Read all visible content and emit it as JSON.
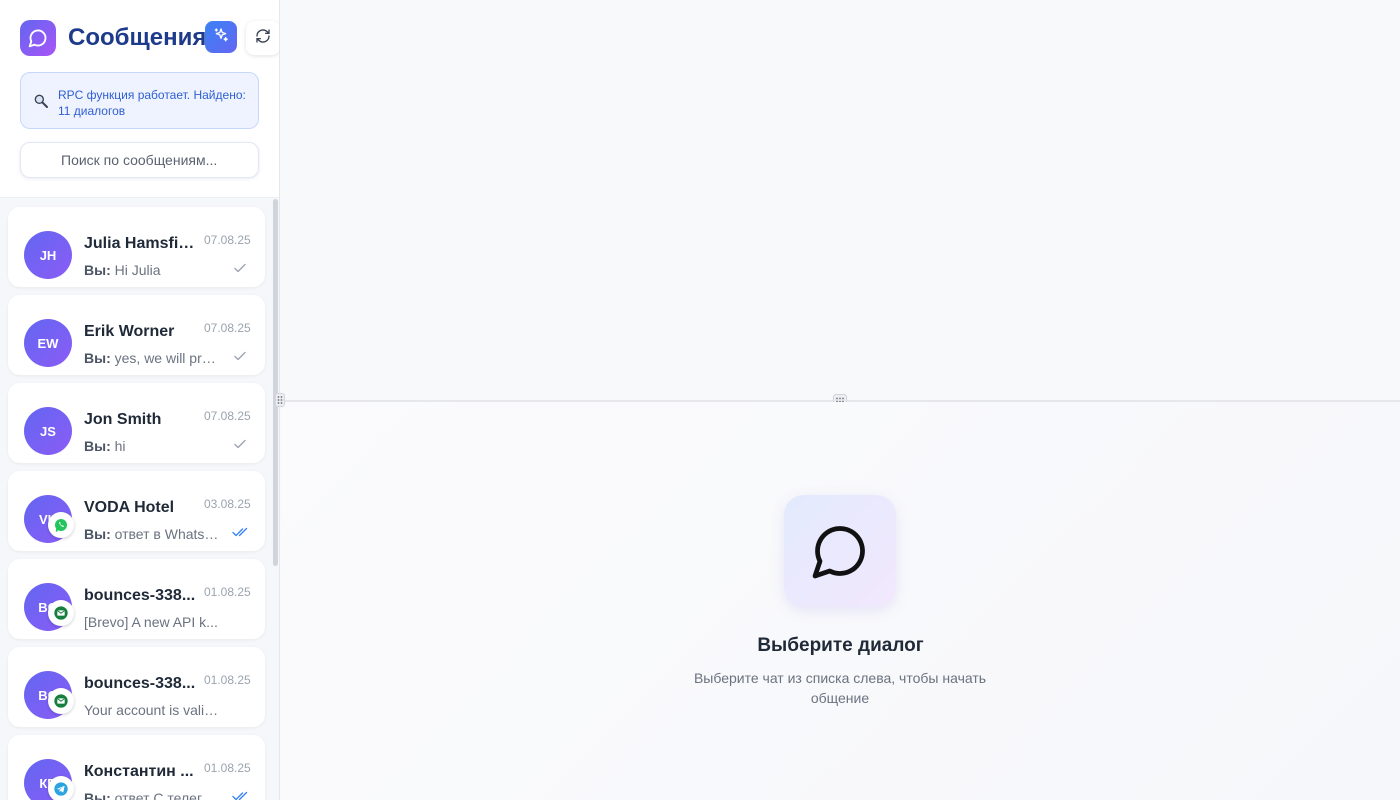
{
  "sidebar": {
    "title": "Сообщения",
    "rpc_status": "RPC функция работает. Найдено: 11 диалогов",
    "search": {
      "placeholder": "Поиск по сообщениям...",
      "value": ""
    },
    "conversations": [
      {
        "initials": "JH",
        "name": "Julia Hamsfield",
        "date": "07.08.25",
        "sender": "Вы:",
        "preview": "Hi Julia",
        "channel": "",
        "status": "sent"
      },
      {
        "initials": "EW",
        "name": "Erik Worner",
        "date": "07.08.25",
        "sender": "Вы:",
        "preview": "yes, we will pro...",
        "channel": "",
        "status": "sent"
      },
      {
        "initials": "JS",
        "name": "Jon Smith",
        "date": "07.08.25",
        "sender": "Вы:",
        "preview": "hi",
        "channel": "",
        "status": "sent"
      },
      {
        "initials": "VH",
        "name": "VODA Hotel",
        "date": "03.08.25",
        "sender": "Вы:",
        "preview": "ответ в Whatsa...",
        "channel": "whatsapp",
        "status": "read"
      },
      {
        "initials": "BO",
        "name": "bounces-338...",
        "date": "01.08.25",
        "sender": "",
        "preview": "[Brevo] A new API k...",
        "channel": "email",
        "status": ""
      },
      {
        "initials": "BO",
        "name": "bounces-338...",
        "date": "01.08.25",
        "sender": "",
        "preview": "Your account is valid...",
        "channel": "email",
        "status": ""
      },
      {
        "initials": "КП",
        "name": "Константин ...",
        "date": "01.08.25",
        "sender": "Вы:",
        "preview": "ответ С телеги ...",
        "channel": "telegram",
        "status": "read"
      }
    ]
  },
  "main": {
    "empty_title": "Выберите диалог",
    "empty_description": "Выберите чат из списка слева, чтобы начать общение"
  },
  "colors": {
    "accent": "#6366f1",
    "title": "#1e3a8a",
    "rpc_text": "#2f5fd0",
    "whatsapp": "#22c55e",
    "email": "#15803d",
    "telegram": "#2aa3e0"
  },
  "icons": {
    "app_logo": "chat-bubble-icon",
    "ai": "sparkles-icon",
    "refresh": "refresh-icon",
    "rpc": "magnifier-icon",
    "empty_state": "chat-bubble-icon",
    "whatsapp": "whatsapp-icon",
    "email": "envelope-icon",
    "telegram": "telegram-icon",
    "sent": "check-icon",
    "read": "double-check-icon"
  }
}
